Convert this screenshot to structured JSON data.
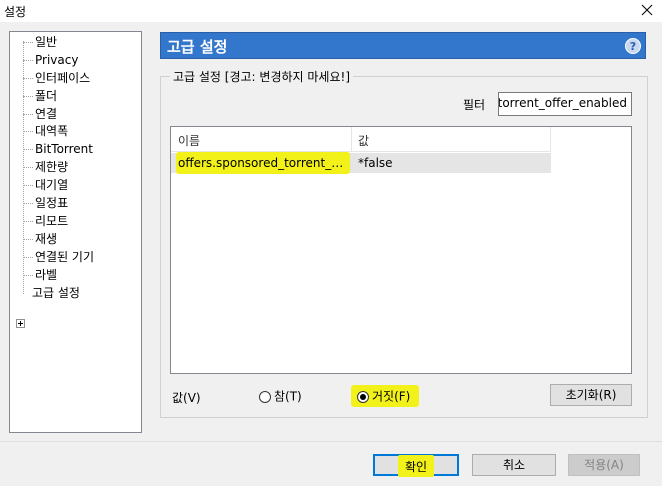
{
  "window": {
    "title": "설정"
  },
  "sidebar": {
    "items": [
      {
        "label": "일반"
      },
      {
        "label": "Privacy"
      },
      {
        "label": "인터페이스"
      },
      {
        "label": "폴더"
      },
      {
        "label": "연결"
      },
      {
        "label": "대역폭"
      },
      {
        "label": "BitTorrent"
      },
      {
        "label": "제한량"
      },
      {
        "label": "대기열"
      },
      {
        "label": "일정표"
      },
      {
        "label": "리모트"
      },
      {
        "label": "재생"
      },
      {
        "label": "연결된 기기"
      },
      {
        "label": "라벨"
      },
      {
        "label": "고급 설정"
      }
    ]
  },
  "header": {
    "title": "고급 설정",
    "help_glyph": "?"
  },
  "group": {
    "legend": "고급 설정 [경고: 변경하지 마세요!]"
  },
  "filter": {
    "label": "필터",
    "value": "offers.sponsored_torrent_offer_enabled"
  },
  "table": {
    "columns": [
      "이름",
      "값"
    ],
    "rows": [
      {
        "name": "offers.sponsored_torrent_offer...",
        "value": "*false"
      }
    ]
  },
  "value_editor": {
    "label": "값(V)",
    "true_option": "참(T)",
    "false_option": "거짓(F)",
    "selected": "false",
    "reset_label": "초기화(R)"
  },
  "buttons": {
    "ok": "확인",
    "cancel": "취소",
    "apply": "적용(A)"
  },
  "colors": {
    "header_bg": "#3377cc",
    "highlight": "#f2f21a",
    "focus_border": "#0078d7"
  }
}
